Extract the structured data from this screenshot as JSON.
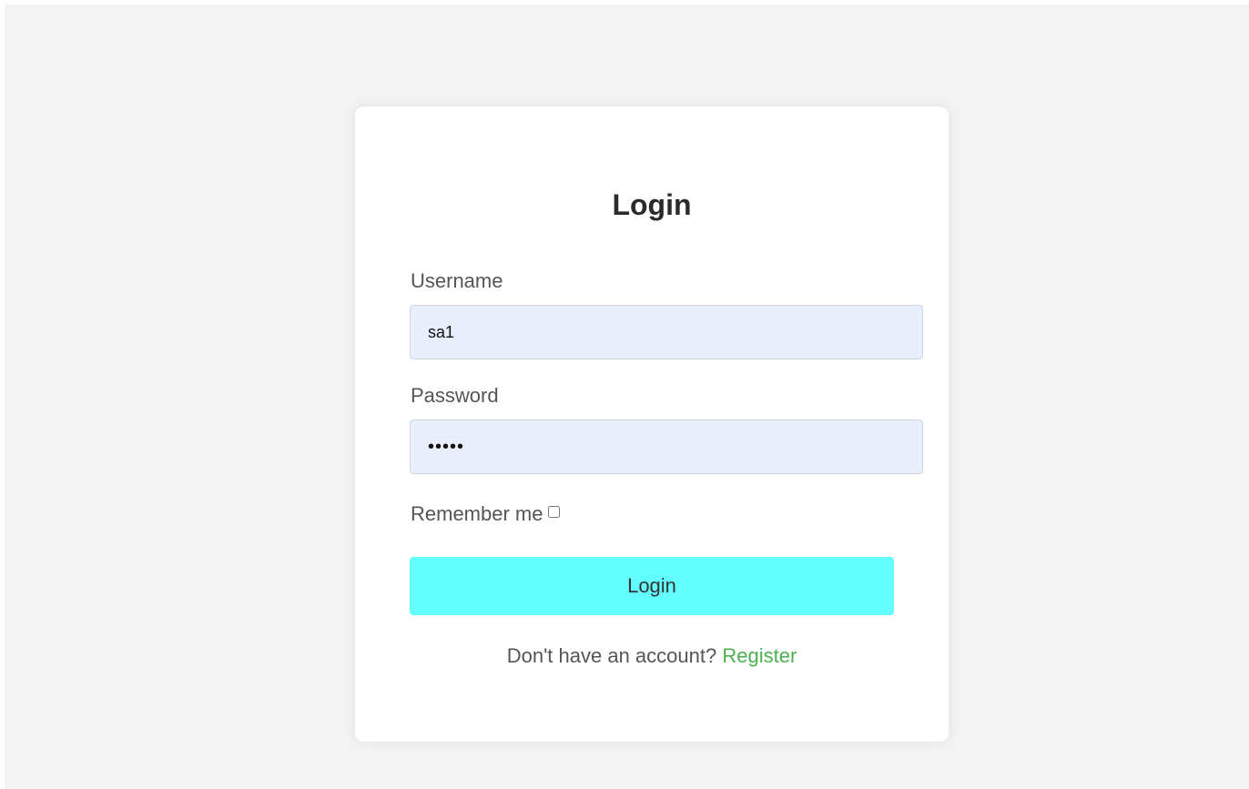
{
  "form": {
    "title": "Login",
    "username_label": "Username",
    "username_value": "sa1",
    "password_label": "Password",
    "password_value": "•••••",
    "remember_label": "Remember me",
    "remember_checked": false,
    "submit_label": "Login",
    "register_prompt": "Don't have an account?",
    "register_link": "Register"
  },
  "colors": {
    "page_background": "#f3f3f3",
    "card_background": "#ffffff",
    "input_background": "#e8effb",
    "button_background": "#63ffff",
    "link_color": "#4caf50"
  }
}
